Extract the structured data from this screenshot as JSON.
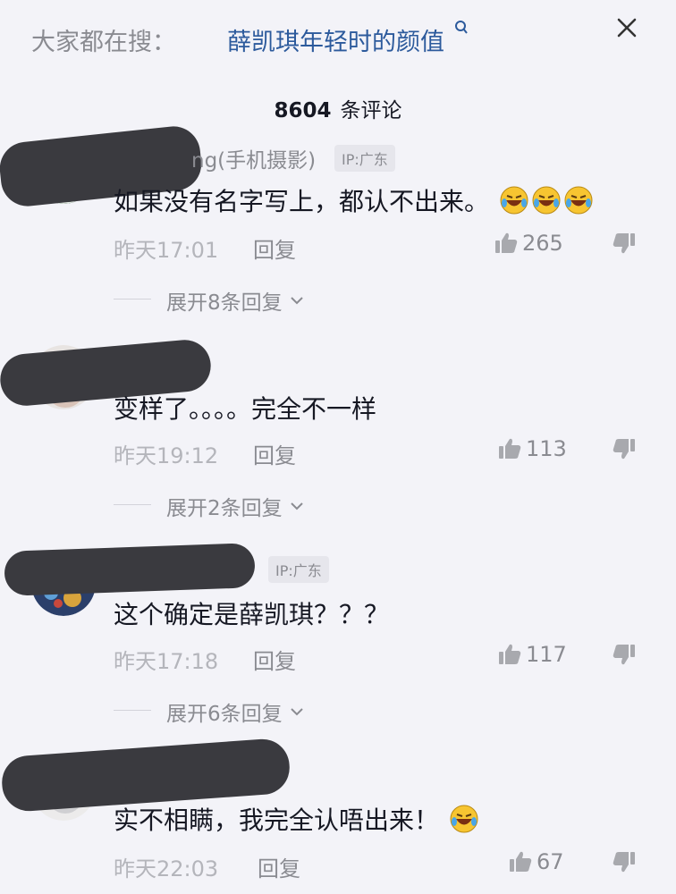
{
  "search": {
    "label": "大家都在搜：",
    "term": "薛凯琪年轻时的颜值"
  },
  "header": {
    "count": "8604",
    "count_unit": "条评论"
  },
  "comments": [
    {
      "username_fragment": "ng(手机摄影)",
      "ip": "IP:广东",
      "text": "如果没有名字写上，都认不出来。",
      "emoji_count": 3,
      "time": "昨天17:01",
      "reply_label": "回复",
      "likes": "265",
      "expand_label": "展开8条回复"
    },
    {
      "username_fragment": "",
      "ip": "",
      "text": "变样了。。。。完全不一样",
      "emoji_count": 0,
      "time": "昨天19:12",
      "reply_label": "回复",
      "likes": "113",
      "expand_label": "展开2条回复"
    },
    {
      "username_fragment": "",
      "ip": "IP:广东",
      "text": "这个确定是薛凯琪？？？",
      "emoji_count": 0,
      "time": "昨天17:18",
      "reply_label": "回复",
      "likes": "117",
      "expand_label": "展开6条回复"
    },
    {
      "username_fragment": "",
      "ip": "",
      "text": "实不相瞒，我完全认唔出来！",
      "emoji_count": 1,
      "time": "昨天22:03",
      "reply_label": "回复",
      "likes": "67",
      "expand_label": ""
    }
  ],
  "colors": {
    "background": "#f3f3f8",
    "link": "#2c5a9c",
    "muted": "#8a8b91",
    "text": "#161823"
  },
  "icons": [
    "search-icon",
    "close-icon",
    "thumbs-up-icon",
    "thumbs-down-icon",
    "chevron-down-icon",
    "laughing-emoji-icon"
  ]
}
